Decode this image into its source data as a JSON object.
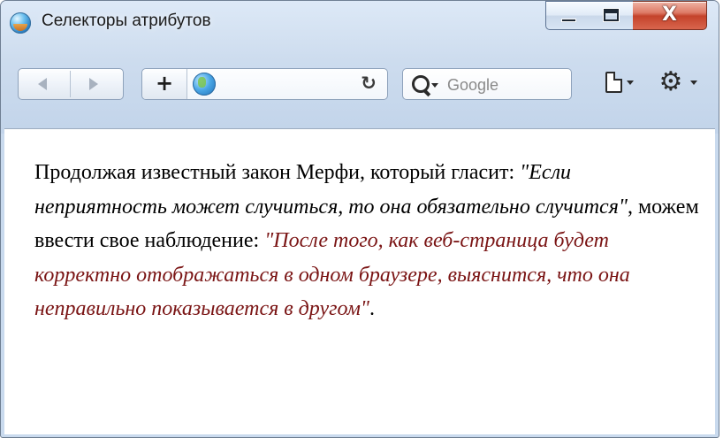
{
  "window": {
    "title": "Селекторы атрибутов",
    "icons": {
      "app": "browser-globe-icon",
      "minimize": "minimize-icon",
      "maximize": "maximize-icon",
      "close": "close-icon"
    },
    "close_glyph": "X"
  },
  "toolbar": {
    "back_icon": "back-arrow-icon",
    "forward_icon": "forward-arrow-icon",
    "add_bookmark_label": "+",
    "address_value": "",
    "reload_glyph": "↻",
    "search_placeholder": "Google",
    "page_menu_icon": "page-icon",
    "tools_menu_icon": "gear-icon"
  },
  "page": {
    "text_part1": "Продолжая известный закон Мерфи, который гласит: ",
    "quote1": "\"Если неприятность может случиться, то она обязательно случится\"",
    "text_part2": ", можем ввести свое наблюдение: ",
    "quote2": "\"После того, как веб-страница будет корректно отображаться в одном браузере, выяснится, что она неправильно показывается в другом\"",
    "text_part3": "."
  },
  "colors": {
    "quote2": "#7a1414",
    "close_button": "#c4432b",
    "frame": "#c9daee"
  }
}
